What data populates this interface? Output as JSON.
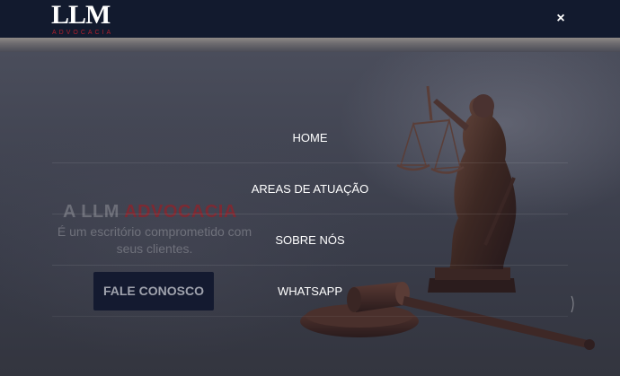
{
  "header": {
    "logo_text": "LLM",
    "logo_subtext": "ADVOCACIA",
    "close_icon": "×"
  },
  "hero": {
    "title_prefix": "A LLM ",
    "title_accent": "ADVOCACIA",
    "subtitle": "É um escritório comprometido com seus clientes.",
    "cta_label": "FALE CONOSCO"
  },
  "menu": {
    "items": [
      {
        "label": "HOME"
      },
      {
        "label": "AREAS DE ATUAÇÃO"
      },
      {
        "label": "SOBRE NÓS"
      },
      {
        "label": "WHATSAPP"
      }
    ]
  },
  "colors": {
    "header_bg": "#121a2e",
    "accent_red": "#b0202c",
    "cta_bg": "#141a30"
  }
}
